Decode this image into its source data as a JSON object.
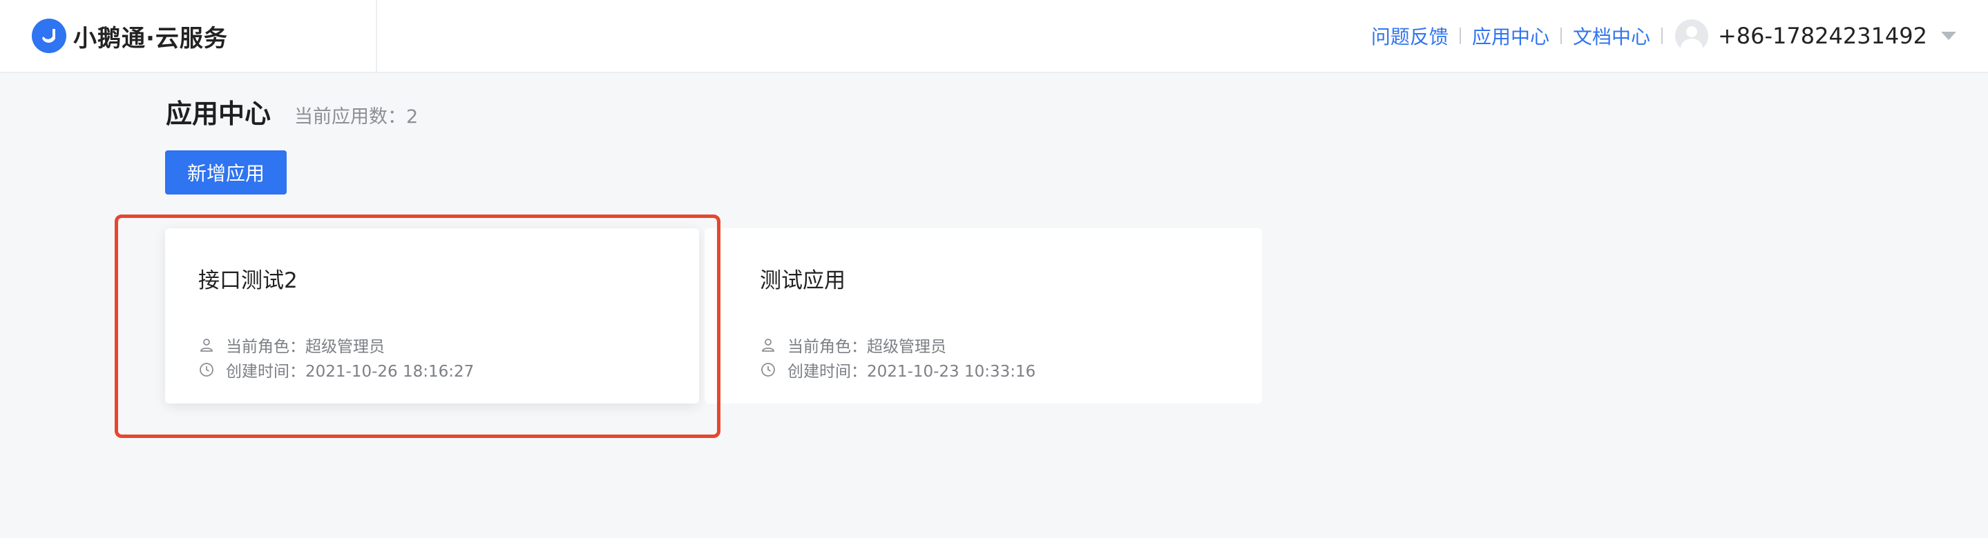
{
  "header": {
    "brand_name": "小鹅通·云服务",
    "links": [
      "问题反馈",
      "应用中心",
      "文档中心"
    ],
    "phone": "+86-17824231492"
  },
  "page": {
    "title": "应用中心",
    "count_text": "当前应用数：2",
    "add_button_label": "新增应用"
  },
  "apps": [
    {
      "name": "接口测试2",
      "role_text": "当前角色：超级管理员",
      "created_text": "创建时间：2021-10-26 18:16:27"
    },
    {
      "name": "测试应用",
      "role_text": "当前角色：超级管理员",
      "created_text": "创建时间：2021-10-23 10:33:16"
    }
  ],
  "colors": {
    "accent": "#2f74f0",
    "highlight": "#e5472f",
    "background": "#f6f7f9"
  },
  "icons": {
    "brand": "goose-logo-icon",
    "role": "user-icon",
    "time": "clock-icon",
    "dropdown": "caret-down-icon"
  }
}
